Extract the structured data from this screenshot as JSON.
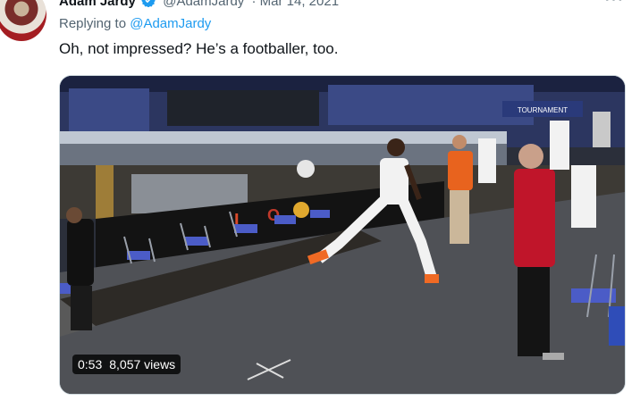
{
  "tweet": {
    "display_name": "Adam Jardy",
    "handle": "@AdamJardy",
    "date": "· Mar 14, 2021",
    "more_icon": "more-icon",
    "reply_prefix": "Replying to",
    "reply_handle": "@AdamJardy",
    "text": "Oh, not impressed? He’s a footballer, too."
  },
  "video": {
    "duration": "0:53",
    "views": "8,057 views",
    "banner_text": "TOURNAMENT"
  },
  "colors": {
    "verified": "#1d9bf0",
    "link": "#1d9bf0",
    "muted": "#536471"
  }
}
